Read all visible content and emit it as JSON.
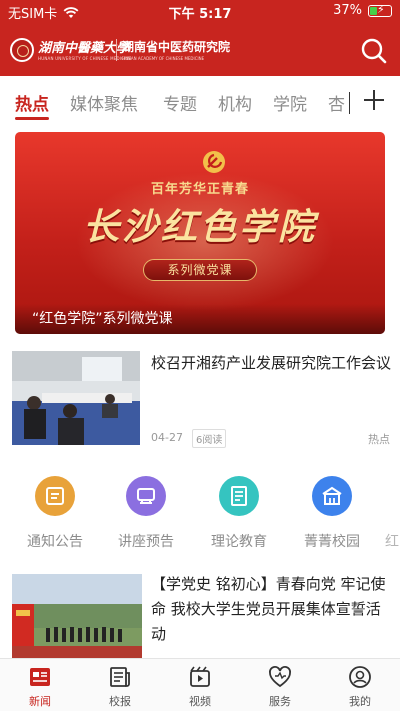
{
  "status_bar": {
    "carrier": "无SIM卡",
    "time": "下午 5:17",
    "battery": "37%",
    "battery_level": 0.37
  },
  "header": {
    "university_name": "湖南中醫藥大學",
    "university_sub": "HUNAN UNIVERSITY OF CHINESE MEDICINE",
    "academy_name": "湖南省中医药研究院",
    "academy_sub": "HUNAN ACADEMY OF CHINESE MEDICINE",
    "search_icon": "search-icon"
  },
  "tabs": [
    {
      "label": "热点",
      "active": true
    },
    {
      "label": "媒体聚焦",
      "active": false
    },
    {
      "label": "专题",
      "active": false
    },
    {
      "label": "机构",
      "active": false
    },
    {
      "label": "学院",
      "active": false
    },
    {
      "label": "杏",
      "active": false
    }
  ],
  "banner": {
    "top_line": "百年芳华正青春",
    "main_title": "长沙红色学院",
    "pill": "系列微党课",
    "caption": "“红色学院”系列微党课"
  },
  "news": [
    {
      "title": "校召开湘药产业发展研究院工作会议",
      "date": "04-27",
      "reads": "6阅读",
      "tag": "热点"
    },
    {
      "title": "【学党史 铭初心】青春向党 牢记使命 我校大学生党员开展集体宣誓活动"
    }
  ],
  "quick_links": [
    {
      "label": "通知公告",
      "icon": "notice-icon",
      "color": "#e8a23a"
    },
    {
      "label": "讲座预告",
      "icon": "lecture-icon",
      "color": "#8b6fe0"
    },
    {
      "label": "理论教育",
      "icon": "book-icon",
      "color": "#35c4c0"
    },
    {
      "label": "菁菁校园",
      "icon": "campus-icon",
      "color": "#3d82ec"
    },
    {
      "label": "红",
      "icon": "",
      "color": "#ffffff"
    }
  ],
  "bottom_nav": [
    {
      "label": "新闻",
      "icon": "news-icon",
      "active": true
    },
    {
      "label": "校报",
      "icon": "newspaper-icon",
      "active": false
    },
    {
      "label": "视频",
      "icon": "video-icon",
      "active": false
    },
    {
      "label": "服务",
      "icon": "service-icon",
      "active": false
    },
    {
      "label": "我的",
      "icon": "profile-icon",
      "active": false
    }
  ],
  "colors": {
    "brand_red": "#c8251f",
    "inactive_text": "#8d8d8d"
  }
}
